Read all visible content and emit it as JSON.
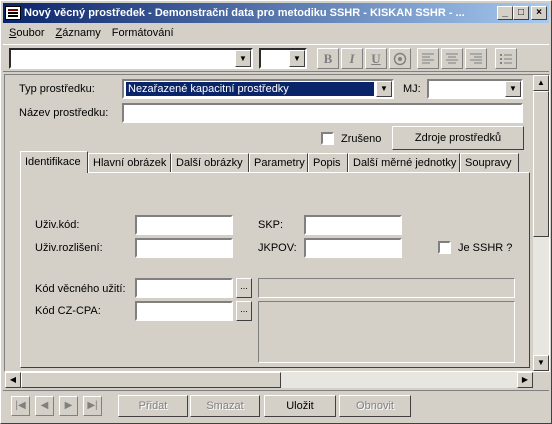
{
  "window": {
    "title": "Nový věcný prostředek - Demonstrační data pro metodiku SSHR - KISKAN SSHR - ...",
    "minimize": "_",
    "maximize": "□",
    "close": "×"
  },
  "menu": {
    "items": [
      "Soubor",
      "Záznamy",
      "Formátování"
    ]
  },
  "toolbar": {
    "font_value": "",
    "size_value": "",
    "bold": "B",
    "italic": "I",
    "underline": "U"
  },
  "form": {
    "typ_label": "Typ prostředku:",
    "typ_value": "Nezařazené kapacitní prostředky",
    "mj_label": "MJ:",
    "mj_value": "",
    "nazev_label": "Název prostředku:",
    "nazev_value": "",
    "zruseno_label": "Zrušeno",
    "zruseno_checked": false,
    "zdroje_button": "Zdroje prostředků"
  },
  "tabs": [
    {
      "label": "Identifikace",
      "active": true
    },
    {
      "label": "Hlavní obrázek",
      "active": false
    },
    {
      "label": "Další obrázky",
      "active": false
    },
    {
      "label": "Parametry",
      "active": false
    },
    {
      "label": "Popis",
      "active": false
    },
    {
      "label": "Další měrné jednotky",
      "active": false
    },
    {
      "label": "Soupravy",
      "active": false
    }
  ],
  "identifikace": {
    "uziv_kod_label": "Uživ.kód:",
    "uziv_kod_value": "",
    "skp_label": "SKP:",
    "skp_value": "",
    "uziv_rozliseni_label": "Uživ.rozlišení:",
    "uziv_rozliseni_value": "",
    "jkpov_label": "JKPOV:",
    "jkpov_value": "",
    "je_sshr_label": "Je SSHR ?",
    "je_sshr_checked": false,
    "kod_vecneho_label": "Kód věcného užití:",
    "kod_vecneho_value": "",
    "kod_czcpa_label": "Kód CZ-CPA:",
    "kod_czcpa_value": "",
    "browse": "..."
  },
  "bottom": {
    "pridat": "Přidat",
    "smazat": "Smazat",
    "ulozit": "Uložit",
    "obnovit": "Obnovit"
  }
}
